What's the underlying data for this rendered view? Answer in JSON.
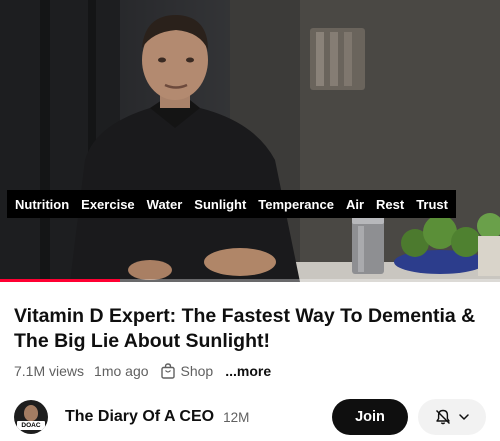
{
  "video": {
    "captions": [
      "Nutrition",
      "Exercise",
      "Water",
      "Sunlight",
      "Temperance",
      "Air",
      "Rest",
      "Trust"
    ],
    "progress_fraction": 0.24,
    "progress_color": "#ff0033"
  },
  "title": "Vitamin D Expert: The Fastest Way To Dementia & The Big Lie About Sunlight!",
  "meta": {
    "views": "7.1M views",
    "age": "1mo ago",
    "shop_label": "Shop",
    "more_label": "...more"
  },
  "channel": {
    "avatar_text": "DOAC",
    "name": "The Diary Of A CEO",
    "subscribers": "12M",
    "join_label": "Join"
  },
  "icons": {
    "shop": "shopping-bag-icon",
    "notifications": "bell-off-icon",
    "dropdown": "chevron-down-icon"
  }
}
